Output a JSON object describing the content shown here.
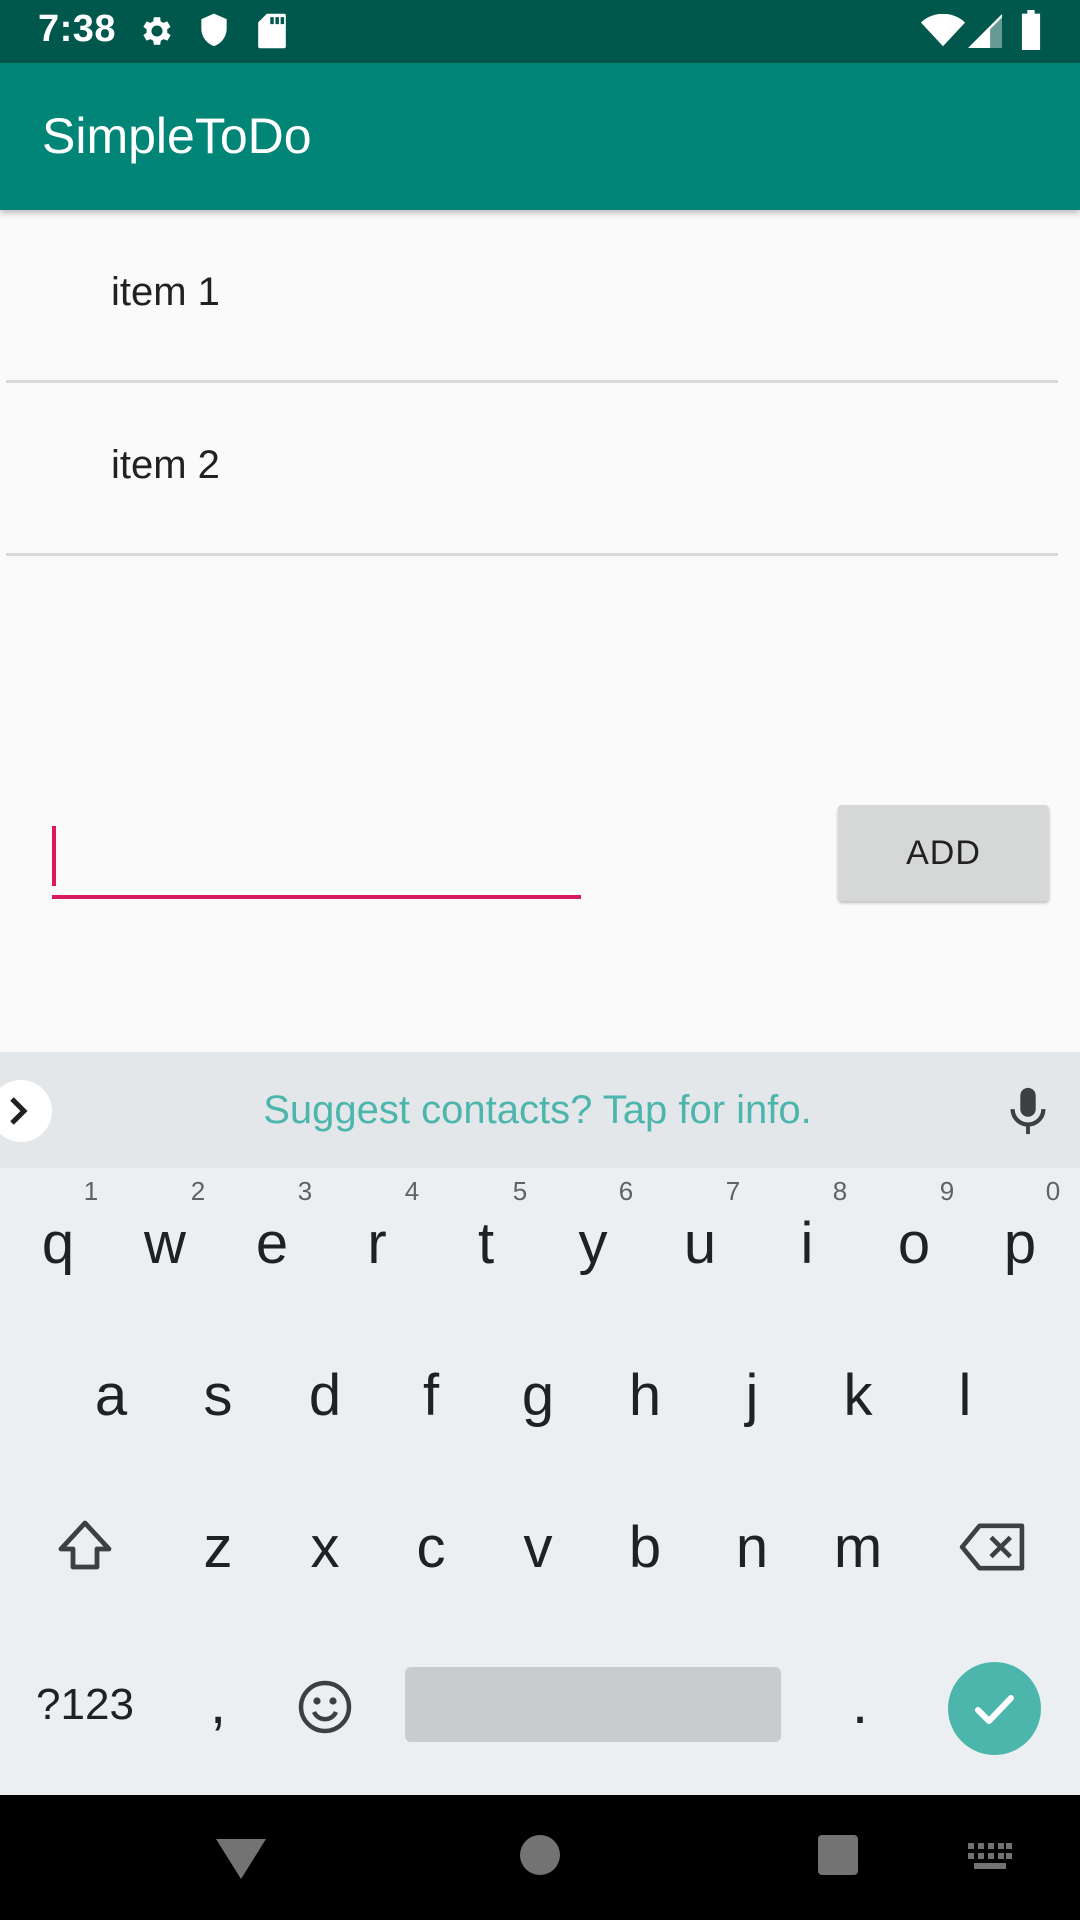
{
  "status_bar": {
    "time": "7:38",
    "icons": [
      "settings-icon",
      "shield-icon",
      "sd-card-icon",
      "wifi-icon",
      "signal-icon",
      "battery-icon"
    ]
  },
  "app_bar": {
    "title": "SimpleToDo"
  },
  "todo_list": {
    "items": [
      {
        "label": "item 1"
      },
      {
        "label": "item 2"
      }
    ]
  },
  "input": {
    "value": "",
    "add_label": "ADD"
  },
  "keyboard": {
    "suggestion": "Suggest contacts? Tap for info.",
    "row1": [
      "q",
      "w",
      "e",
      "r",
      "t",
      "y",
      "u",
      "i",
      "o",
      "p"
    ],
    "row1_hints": [
      "1",
      "2",
      "3",
      "4",
      "5",
      "6",
      "7",
      "8",
      "9",
      "0"
    ],
    "row2": [
      "a",
      "s",
      "d",
      "f",
      "g",
      "h",
      "j",
      "k",
      "l"
    ],
    "row3": [
      "z",
      "x",
      "c",
      "v",
      "b",
      "n",
      "m"
    ],
    "symbols_label": "?123",
    "comma": ",",
    "period": "."
  },
  "colors": {
    "primary": "#008577",
    "primary_dark": "#00574b",
    "accent": "#d81b60",
    "keyboard_accent": "#4db6ac"
  }
}
